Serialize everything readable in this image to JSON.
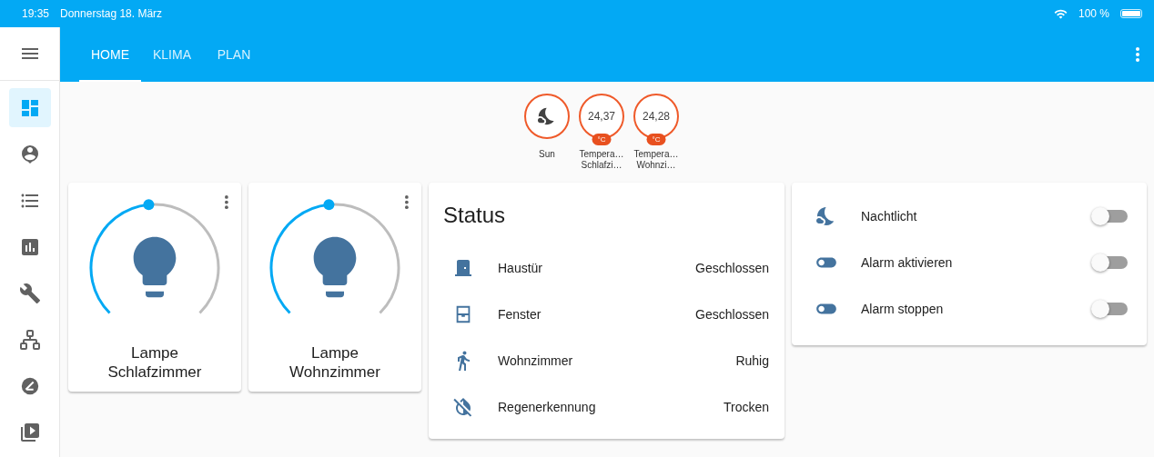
{
  "status_bar": {
    "time": "19:35",
    "date": "Donnerstag 18. März",
    "battery": "100 %"
  },
  "sidebar": {
    "items": [
      {
        "kind": "dashboard",
        "selected": true
      },
      {
        "kind": "map",
        "selected": false
      },
      {
        "kind": "logbook",
        "selected": false
      },
      {
        "kind": "history",
        "selected": false
      },
      {
        "kind": "config",
        "selected": false
      },
      {
        "kind": "network",
        "selected": false
      },
      {
        "kind": "zwave",
        "selected": false
      },
      {
        "kind": "media",
        "selected": false
      }
    ]
  },
  "tabs": [
    {
      "label": "HOME",
      "selected": true
    },
    {
      "label": "KLIMA",
      "selected": false
    },
    {
      "label": "PLAN",
      "selected": false
    }
  ],
  "badges": [
    {
      "kind": "icon",
      "label": [
        "Sun"
      ]
    },
    {
      "kind": "value",
      "value": "24,37",
      "unit": "°C",
      "label": [
        "Tempera…",
        "Schlafzi…"
      ]
    },
    {
      "kind": "value",
      "value": "24,28",
      "unit": "°C",
      "label": [
        "Tempera…",
        "Wohnzi…"
      ]
    }
  ],
  "lights": [
    {
      "name": "Lampe Schlafzimmer",
      "level": 0.48
    },
    {
      "name": "Lampe Wohnzimmer",
      "level": 0.48
    }
  ],
  "status_card": {
    "title": "Status",
    "rows": [
      {
        "kind": "door",
        "name": "Haustür",
        "state": "Geschlossen"
      },
      {
        "kind": "window",
        "name": "Fenster",
        "state": "Geschlossen"
      },
      {
        "kind": "motion",
        "name": "Wohnzimmer",
        "state": "Ruhig"
      },
      {
        "kind": "rain",
        "name": "Regenerkennung",
        "state": "Trocken"
      }
    ]
  },
  "entities": [
    {
      "kind": "night",
      "name": "Nachtlicht",
      "on": false
    },
    {
      "kind": "toggle",
      "name": "Alarm aktivieren",
      "on": false
    },
    {
      "kind": "toggle",
      "name": "Alarm stoppen",
      "on": false
    }
  ]
}
